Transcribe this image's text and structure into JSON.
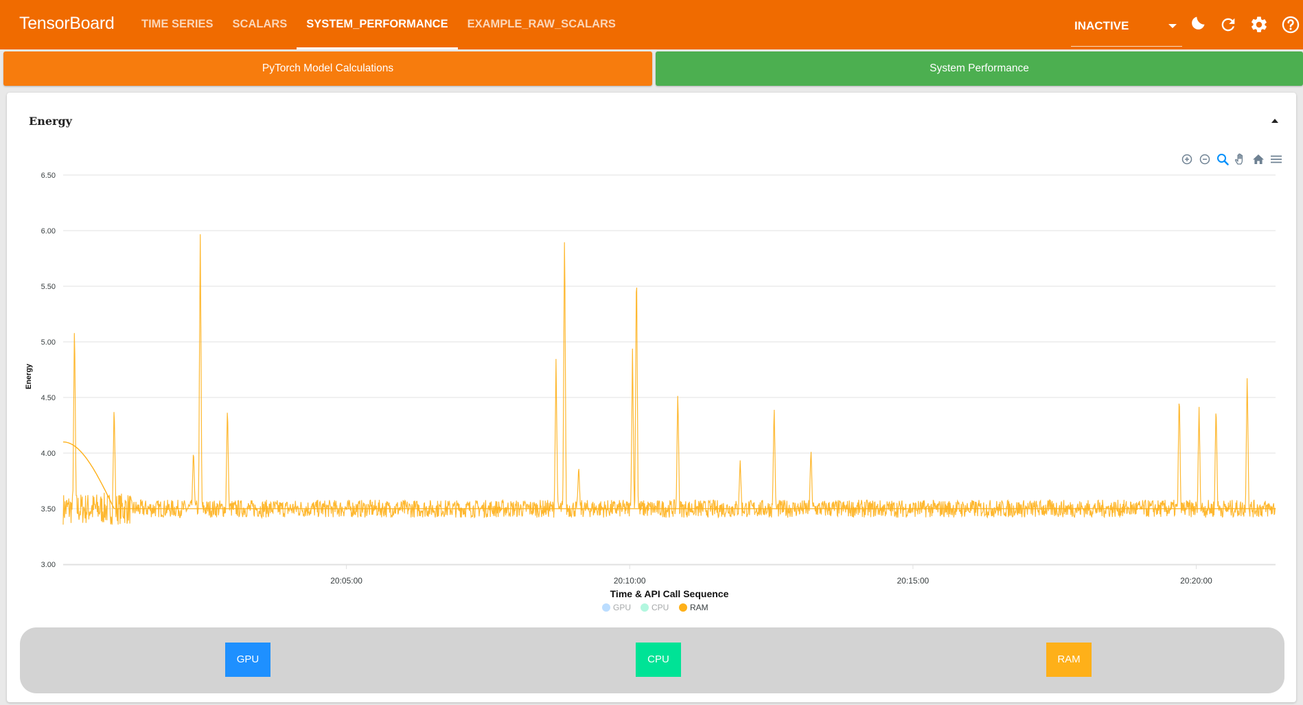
{
  "app": {
    "brand": "TensorBoard",
    "tabs": [
      {
        "label": "TIME SERIES",
        "active": false
      },
      {
        "label": "SCALARS",
        "active": false
      },
      {
        "label": "SYSTEM_PERFORMANCE",
        "active": true
      },
      {
        "label": "EXAMPLE_RAW_SCALARS",
        "active": false
      }
    ],
    "status_select": {
      "value": "INACTIVE"
    },
    "icons": [
      "dark-mode-icon",
      "reload-icon",
      "settings-icon",
      "help-icon"
    ]
  },
  "colors": {
    "topbar": "#f06b00",
    "pytorch_button": "#f77c0d",
    "system_button": "#4caf50",
    "gpu": "#1e90ff",
    "cpu": "#00e396",
    "ram": "#feb019"
  },
  "modules": {
    "pytorch": "PyTorch Model Calculations",
    "system": "System Performance"
  },
  "card": {
    "title": "Energy"
  },
  "toolbar": [
    "zoom-in-icon",
    "zoom-out-icon",
    "zoom-select-icon",
    "pan-icon",
    "reset-home-icon",
    "menu-icon"
  ],
  "chart_data": {
    "type": "line",
    "xlabel": "Time & API Call Sequence",
    "ylabel": "Energy",
    "ylim": [
      3.0,
      6.5
    ],
    "y_ticks": [
      "6.50",
      "6.00",
      "5.50",
      "5.00",
      "4.50",
      "4.00",
      "3.50",
      "3.00"
    ],
    "x_ticks": [
      "20:05:00",
      "20:10:00",
      "20:15:00",
      "20:20:00"
    ],
    "x_tick_positions_min": [
      5,
      10,
      15,
      20
    ],
    "xlim_min": [
      0,
      21.4
    ],
    "grid": true,
    "legend_position": "bottom",
    "legend": [
      {
        "name": "GPU",
        "enabled": false
      },
      {
        "name": "CPU",
        "enabled": false
      },
      {
        "name": "RAM",
        "enabled": true
      }
    ],
    "series": [
      {
        "name": "RAM",
        "baseline": 3.5,
        "noise": 0.08,
        "spikes": [
          {
            "x": 0.2,
            "y": 5.22
          },
          {
            "x": 0.9,
            "y": 4.46
          },
          {
            "x": 2.3,
            "y": 4.05
          },
          {
            "x": 2.42,
            "y": 5.98
          },
          {
            "x": 2.9,
            "y": 4.45
          },
          {
            "x": 8.7,
            "y": 4.85
          },
          {
            "x": 8.85,
            "y": 6.06
          },
          {
            "x": 9.1,
            "y": 3.9
          },
          {
            "x": 10.05,
            "y": 4.95
          },
          {
            "x": 10.12,
            "y": 5.78
          },
          {
            "x": 10.85,
            "y": 4.58
          },
          {
            "x": 11.95,
            "y": 3.95
          },
          {
            "x": 12.55,
            "y": 4.45
          },
          {
            "x": 13.2,
            "y": 4.05
          },
          {
            "x": 19.7,
            "y": 4.58
          },
          {
            "x": 20.05,
            "y": 4.42
          },
          {
            "x": 20.35,
            "y": 4.47
          },
          {
            "x": 20.9,
            "y": 4.76
          }
        ]
      }
    ],
    "buttons": [
      "GPU",
      "CPU",
      "RAM"
    ]
  }
}
